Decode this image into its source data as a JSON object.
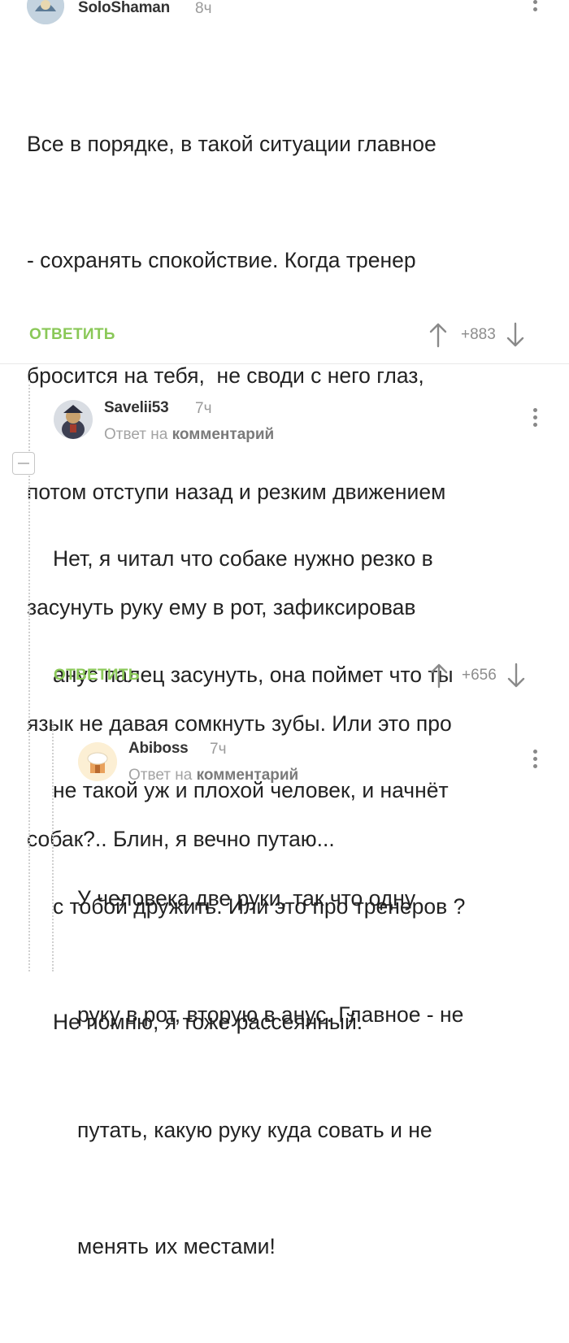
{
  "comments": [
    {
      "author": "SoloShaman",
      "time": "8ч",
      "text_lines": [
        "Все в порядке, в такой ситуации главное",
        "- сохранять спокойствие. Когда тренер",
        "бросится на тебя,  не своди с него глаз,",
        "потом отступи назад и резким движением",
        "засунуть руку ему в рот, зафиксировав",
        "язык не давая сомкнуть зубы. Или это про",
        "собак?.. Блин, я вечно путаю..."
      ],
      "reply_label": "ОТВЕТИТЬ",
      "rating": "+883"
    },
    {
      "author": "Savelii53",
      "time": "7ч",
      "reply_to_prefix": "Ответ на",
      "reply_to_target": "комментарий",
      "text_lines": [
        "Нет, я читал что собаке нужно резко в",
        "анус палец засунуть, она поймет что ты",
        "не такой уж и плохой человек, и начнёт",
        "с тобой дружить. Или это про тренеров ?",
        "Не помню, я тоже рассеянный."
      ],
      "reply_label": "ОТВЕТИТЬ",
      "rating": "+656"
    },
    {
      "author": "Abiboss",
      "time": "7ч",
      "reply_to_prefix": "Ответ на",
      "reply_to_target": "комментарий",
      "text_lines": [
        "У человека две руки, так что одну",
        "руку в рот, вторую в анус. Главное - не",
        "путать, какую руку куда совать и не",
        "менять их местами!"
      ]
    }
  ],
  "icons": {
    "upvote": "arrow-up-icon",
    "downvote": "arrow-down-icon",
    "menu": "more-vertical-icon",
    "collapse": "minus-square-icon"
  },
  "colors": {
    "reply": "#8ac858",
    "text": "#222222",
    "muted": "#9a9a9a"
  }
}
